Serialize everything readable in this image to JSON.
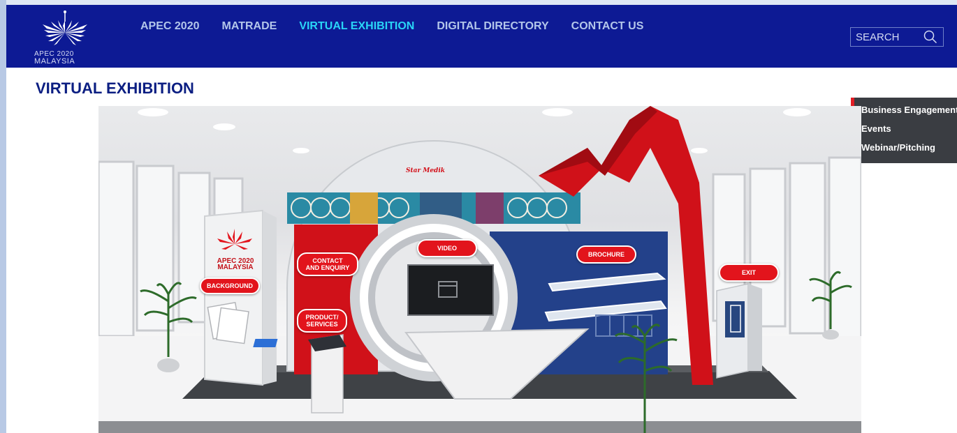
{
  "header": {
    "logo_text_line1": "APEC 2020",
    "logo_text_line2": "MALAYSIA",
    "nav": [
      {
        "label": "APEC 2020",
        "active": false
      },
      {
        "label": "MATRADE",
        "active": false
      },
      {
        "label": "VIRTUAL EXHIBITION",
        "active": true
      },
      {
        "label": "DIGITAL DIRECTORY",
        "active": false
      },
      {
        "label": "CONTACT US",
        "active": false
      }
    ],
    "search_label": "SEARCH",
    "search_icon": "search-icon"
  },
  "page_title": "VIRTUAL EXHIBITION",
  "side_menu": {
    "items": [
      "Business Engagement",
      "Events",
      "Webinar/Pitching"
    ]
  },
  "booth": {
    "brand": "Star Medik",
    "kiosk_logo_line1": "APEC 2020",
    "kiosk_logo_line2": "MALAYSIA",
    "hotspots": {
      "background": "BACKGROUND",
      "contact_line1": "CONTACT",
      "contact_line2": "AND ENQUIRY",
      "products_line1": "PRODUCT/",
      "products_line2": "SERVICES",
      "video": "VIDEO",
      "brochure": "BROCHURE",
      "exit": "EXIT"
    }
  },
  "colors": {
    "header_bg": "#0d1a94",
    "nav_text": "#b3c6ea",
    "nav_active": "#29d5f7",
    "title": "#0b1e82",
    "accent_red": "#e2141c",
    "side_menu_bg": "#3a3d42"
  }
}
